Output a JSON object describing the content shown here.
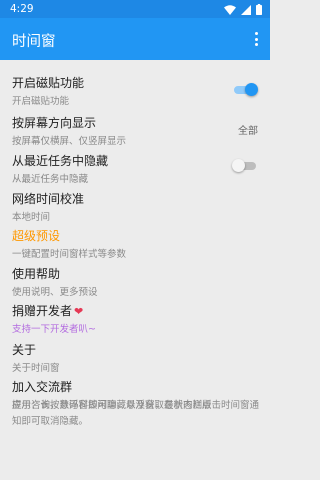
{
  "status_bar": {
    "time": "4:29",
    "icons": [
      "wifi-icon",
      "signal-icon",
      "battery-icon"
    ]
  },
  "app_bar": {
    "title": "时间窗",
    "menu_icon": "more-vert-icon"
  },
  "colors": {
    "status_bar": "#1e88e5",
    "app_bar": "#2196f3",
    "accent": "#2196f3",
    "orange_title": "#ff9800",
    "purple_subtitle": "#b36ce0",
    "background": "#ececec"
  },
  "settings": [
    {
      "title": "开启磁贴功能",
      "subtitle": "开启磁贴功能",
      "control": "switch",
      "checked": true
    },
    {
      "title": "按屏幕方向显示",
      "subtitle": "按屏幕仅横屏、仅竖屏显示",
      "control": "value",
      "value": "全部"
    },
    {
      "title": "从最近任务中隐藏",
      "subtitle": "从最近任务中隐藏",
      "control": "switch",
      "checked": false
    },
    {
      "title": "网络时间校准",
      "subtitle": "本地时间"
    },
    {
      "title": "超级预设",
      "subtitle": "一键配置时间窗样式等参数"
    },
    {
      "title": "使用帮助",
      "subtitle": "使用说明、更多预设"
    },
    {
      "title": "捐赠开发者",
      "title_icon": "heart-icon",
      "subtitle": "支持一下开发者叭~"
    },
    {
      "title": "关于",
      "subtitle": "关于时间窗"
    },
    {
      "title": "加入交流群",
      "subtitle": "应用咨询，数码科技闲聊，以及获取最新内测版"
    }
  ],
  "hint": "提示：长按悬浮窗即可隐藏悬浮窗，在状态栏点击时间窗通知即可取消隐藏。"
}
